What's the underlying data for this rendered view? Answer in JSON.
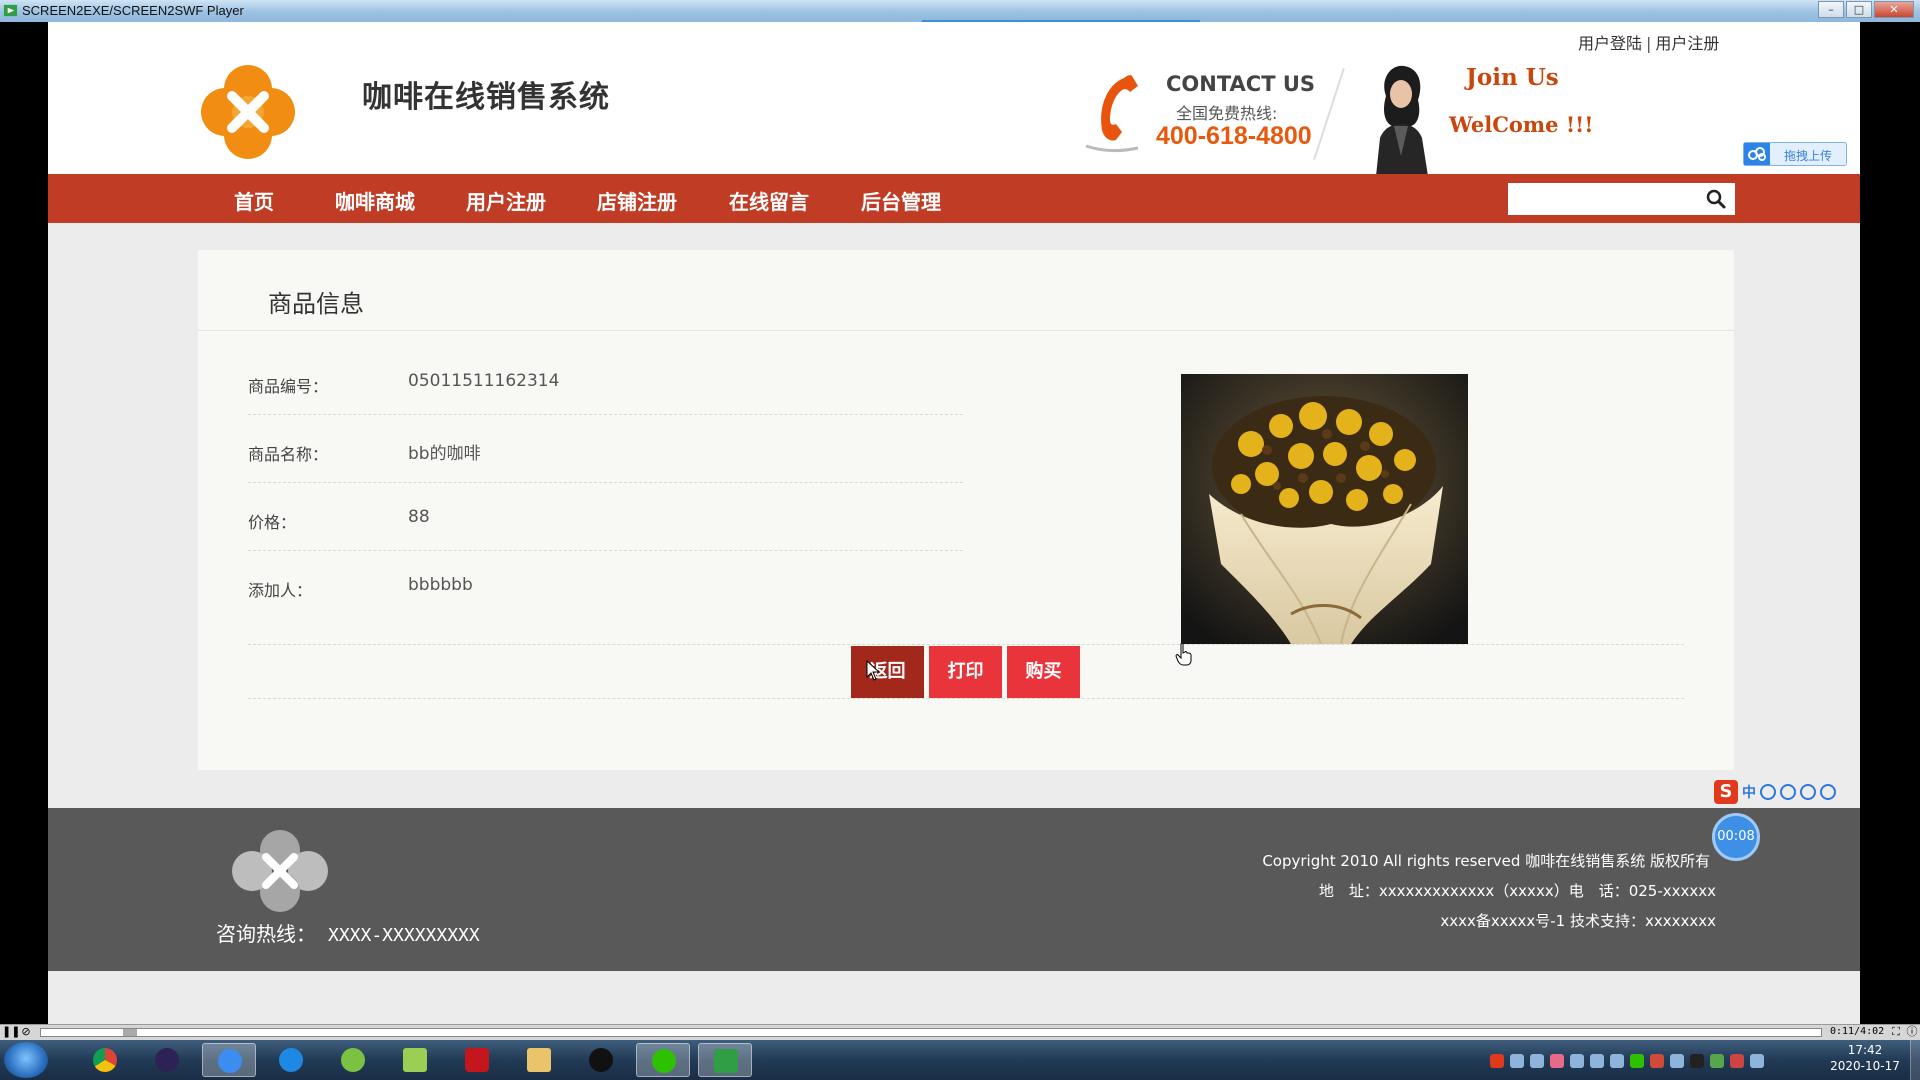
{
  "player": {
    "title": "SCREEN2EXE/SCREEN2SWF Player",
    "timecode": "0:11/4:02"
  },
  "header": {
    "login_link": "用户登陆",
    "separator": "|",
    "register_link": "用户注册",
    "site_title": "咖啡在线销售系统",
    "contact_label": "CONTACT US",
    "hotline_label": "全国免费热线:",
    "hotline_number": "400-618-4800",
    "join_us": "Join Us",
    "welcome": "WelCome !!!",
    "upload_label": "拖拽上传"
  },
  "nav": {
    "items": [
      "首页",
      "咖啡商城",
      "用户注册",
      "店铺注册",
      "在线留言",
      "后台管理"
    ],
    "search_placeholder": ""
  },
  "product": {
    "section_title": "商品信息",
    "fields": [
      {
        "label": "商品编号：",
        "value": "05011511162314"
      },
      {
        "label": "商品名称：",
        "value": "bb的咖啡"
      },
      {
        "label": "价格：",
        "value": "88"
      },
      {
        "label": "添加人：",
        "value": "bbbbbb"
      }
    ],
    "buttons": {
      "back": "返回",
      "print": "打印",
      "buy": "购买"
    }
  },
  "footer": {
    "consult_label": "咨询热线：",
    "consult_phone": "XXXX-XXXXXXXXX",
    "copyright_prefix": "Copyright 2010 All rights reserved",
    "copyright_owner": "咖啡在线销售系统 版权所有",
    "address": "地　址：xxxxxxxxxxxxx（xxxxx）电　话：025-xxxxxx",
    "icp": "xxxx备xxxxx号-1 技术支持：xxxxxxxx"
  },
  "overlay": {
    "ime_label": "中",
    "timer": "00:08"
  },
  "taskbar": {
    "time": "17:42",
    "date": "2020-10-17"
  },
  "colors": {
    "nav_red": "#c03c25",
    "accent_orange": "#e7590e",
    "button_red": "#e8343a",
    "button_dark": "#a3281c",
    "footer_gray": "#595959"
  }
}
